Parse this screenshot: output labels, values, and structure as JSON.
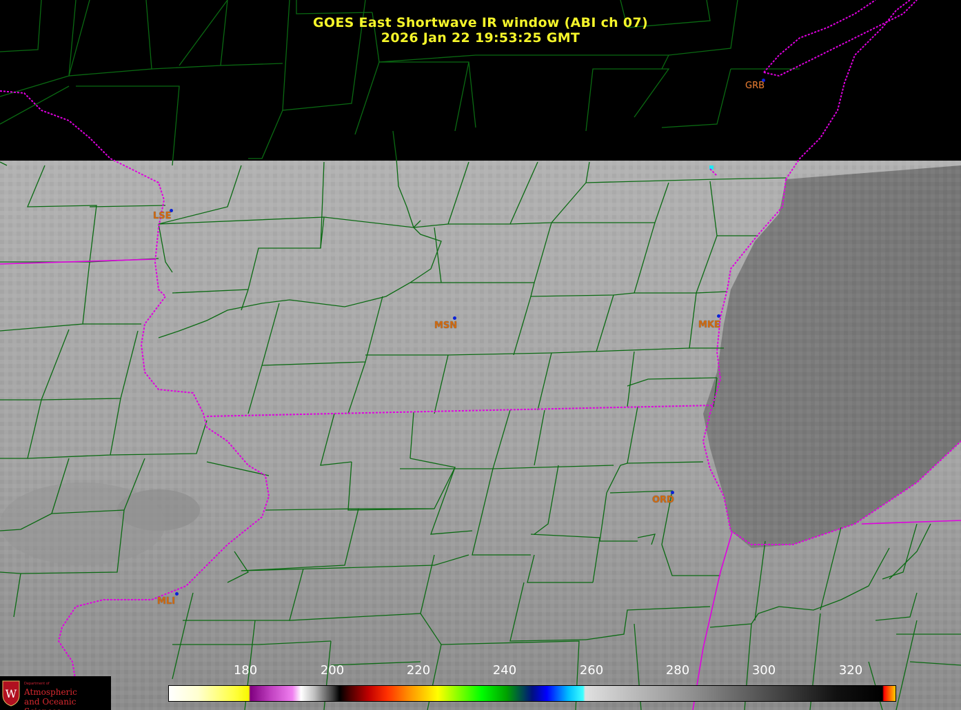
{
  "header": {
    "title": "GOES East Shortwave IR window (ABI ch 07)",
    "timestamp": "2026 Jan 22  19:53:25 GMT"
  },
  "stations": [
    {
      "id": "GRB",
      "label": "GRB"
    },
    {
      "id": "LSE",
      "label": "LSE"
    },
    {
      "id": "MSN",
      "label": "MSN"
    },
    {
      "id": "MKE",
      "label": "MKE"
    },
    {
      "id": "ORD",
      "label": "ORD"
    },
    {
      "id": "MLI",
      "label": "MLI"
    }
  ],
  "colorbar": {
    "ticks": [
      "180",
      "200",
      "220",
      "240",
      "260",
      "280",
      "300",
      "320"
    ]
  },
  "logo": {
    "line1": "Department of",
    "line2": "Atmospheric",
    "line3": "and Oceanic Sciences"
  },
  "colors": {
    "county_lines": "#0a6a12",
    "state_borders": "#e000e0",
    "title": "#f5f52a",
    "station_dot": "#0b22d8",
    "station_label": "#d06a10"
  }
}
